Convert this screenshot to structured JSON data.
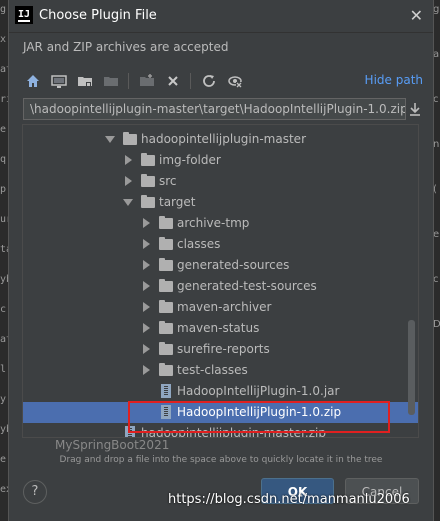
{
  "background": {
    "left_fragments": [
      "g",
      "x",
      "at",
      "ri",
      "e",
      "q",
      "p",
      "ur",
      "ta",
      "yb",
      "c",
      "at",
      "l",
      "y",
      "yb",
      "e",
      "ex"
    ],
    "right_fragments": [
      "g",
      "a",
      "c",
      "n",
      "(",
      "e",
      "c",
      "D"
    ]
  },
  "dialog": {
    "title": "Choose Plugin File",
    "app_icon_letter": "IJ",
    "close_glyph": "✕",
    "subtitle": "JAR and ZIP archives are accepted"
  },
  "toolbar": {
    "hide_path": "Hide path",
    "icons": [
      "home-icon",
      "desktop-icon",
      "project-icon",
      "module-icon",
      "new-folder-icon",
      "delete-icon",
      "refresh-icon",
      "show-hidden-icon"
    ]
  },
  "path": {
    "value": "\\hadoopintellijplugin-master\\target\\HadoopIntellijPlugin-1.0.zip"
  },
  "tree": {
    "items": [
      {
        "label": "hadoopintellijplugin-master",
        "type": "folder",
        "expanded": true
      },
      {
        "label": "img-folder",
        "type": "folder",
        "expanded": false
      },
      {
        "label": "src",
        "type": "folder",
        "expanded": false
      },
      {
        "label": "target",
        "type": "folder",
        "expanded": true
      },
      {
        "label": "archive-tmp",
        "type": "folder",
        "expanded": false
      },
      {
        "label": "classes",
        "type": "folder",
        "expanded": false
      },
      {
        "label": "generated-sources",
        "type": "folder",
        "expanded": false
      },
      {
        "label": "generated-test-sources",
        "type": "folder",
        "expanded": false
      },
      {
        "label": "maven-archiver",
        "type": "folder",
        "expanded": false
      },
      {
        "label": "maven-status",
        "type": "folder",
        "expanded": false
      },
      {
        "label": "surefire-reports",
        "type": "folder",
        "expanded": false
      },
      {
        "label": "test-classes",
        "type": "folder",
        "expanded": false
      },
      {
        "label": "HadoopIntellijPlugin-1.0.jar",
        "type": "file"
      },
      {
        "label": "HadoopIntellijPlugin-1.0.zip",
        "type": "file",
        "selected": true
      },
      {
        "label": "hadoopintellijplugin-master.zip",
        "type": "file"
      }
    ],
    "partial_row": "MySpringBoot2021"
  },
  "hint": "Drag and drop a file into the space above to quickly locate it in the tree",
  "buttons": {
    "help": "?",
    "ok": "OK",
    "cancel": "Cancel"
  },
  "watermark": "https://blog.csdn.net/manmanlu2006",
  "colors": {
    "selection": "#4b6eaf",
    "link": "#589df6",
    "highlight_box": "#e02020",
    "ok_button": "#365880"
  }
}
